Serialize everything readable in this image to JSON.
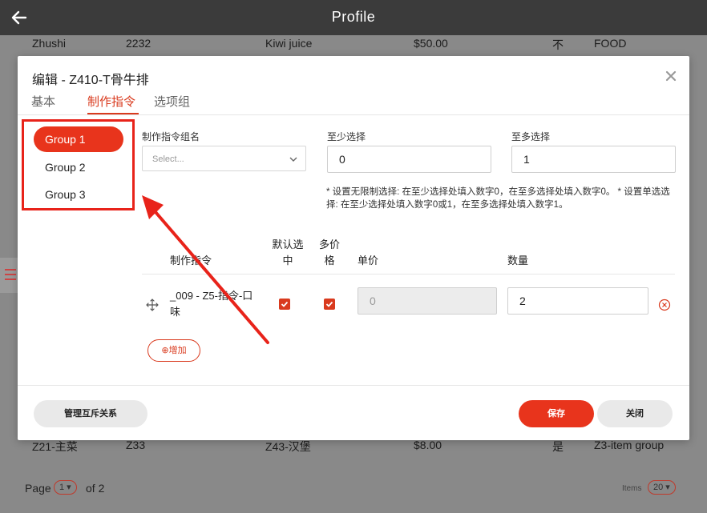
{
  "header": {
    "title": "Profile"
  },
  "background_rows": [
    {
      "c1": "Zhushi",
      "c2": "2232",
      "c3": "Kiwi juice",
      "c4": "$50.00",
      "c5": "不",
      "c6": "FOOD"
    },
    {
      "c1": "Z21-主菜",
      "c2": "Z33",
      "c3": "Z43-汉堡",
      "c4": "$8.00",
      "c5": "是",
      "c6": "Z3-item group"
    }
  ],
  "pager": {
    "page_label": "Page",
    "current_page": "1",
    "of_label": "of 2",
    "items_label": "Items",
    "items_value": "20"
  },
  "modal": {
    "title": "编辑 - Z410-T骨牛排",
    "tabs": [
      {
        "label": "基本"
      },
      {
        "label": "制作指令"
      },
      {
        "label": "选项组"
      }
    ],
    "groups": [
      {
        "label": "Group 1"
      },
      {
        "label": "Group 2"
      },
      {
        "label": "Group 3"
      }
    ],
    "fields": {
      "group_name_label": "制作指令组名",
      "group_name_placeholder": "Select...",
      "min_label": "至少选择",
      "min_value": "0",
      "max_label": "至多选择",
      "max_value": "1"
    },
    "note": "* 设置无限制选择: 在至少选择处填入数字0，在至多选择处填入数字0。 * 设置单选选择: 在至少选择处填入数字0或1，在至多选择处填入数字1。",
    "table": {
      "headers": {
        "name": "制作指令",
        "default_line1": "默认选",
        "default_line2": "中",
        "multi_line1": "多价",
        "multi_line2": "格",
        "price": "单价",
        "qty": "数量"
      },
      "rows": [
        {
          "name": "_009 - Z5-指令-口味",
          "default_checked": true,
          "multi_checked": true,
          "price": "0",
          "qty": "2"
        }
      ]
    },
    "add_label": "增加",
    "buttons": {
      "manage": "管理互斥关系",
      "save": "保存",
      "close": "关闭"
    }
  },
  "colors": {
    "accent": "#e8341c",
    "annotation": "#e8231a",
    "header_bg": "#3b3b3b"
  }
}
